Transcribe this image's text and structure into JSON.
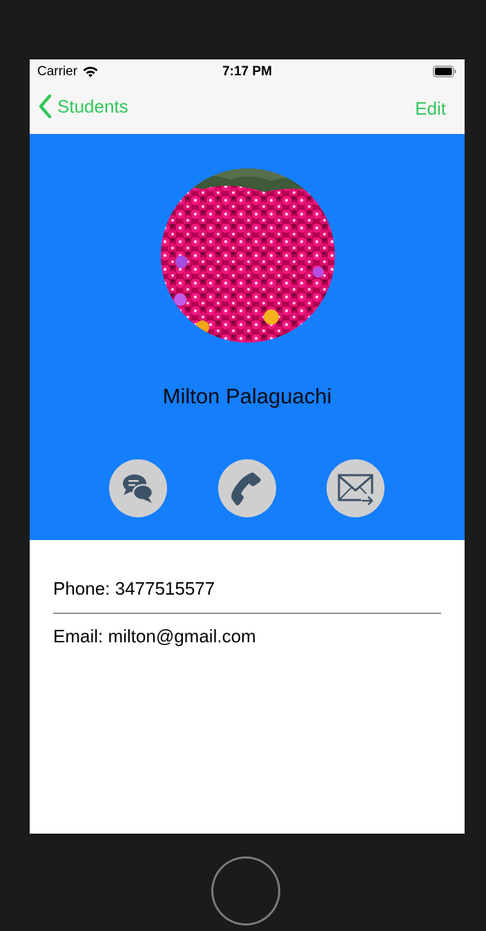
{
  "status_bar": {
    "carrier": "Carrier",
    "time": "7:17 PM"
  },
  "nav": {
    "back_label": "Students",
    "edit_label": "Edit"
  },
  "profile": {
    "name": "Milton Palaguachi",
    "avatar": "flower-photo"
  },
  "actions": [
    {
      "icon": "chat-bubbles-icon"
    },
    {
      "icon": "phone-icon"
    },
    {
      "icon": "mail-forward-icon"
    }
  ],
  "details": {
    "phone": "Phone: 3477515577",
    "email": "Email: milton@gmail.com"
  },
  "colors": {
    "accent": "#33c759",
    "hero_background": "#157efb",
    "action_button": "#cfcfcf",
    "action_icon": "#3d5368"
  }
}
